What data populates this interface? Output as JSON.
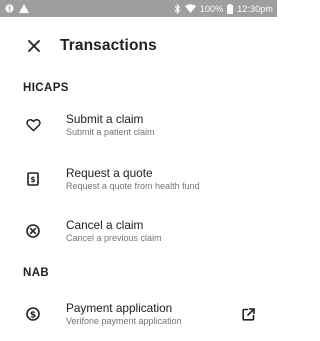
{
  "status_bar": {
    "battery_percent": "100%",
    "time": "12:30pm"
  },
  "header": {
    "title": "Transactions",
    "close_icon": "close-icon"
  },
  "sections": [
    {
      "label": "HICAPS",
      "items": [
        {
          "title": "Submit a claim",
          "subtitle": "Submit a patient claim",
          "icon": "heart-outline-icon"
        },
        {
          "title": "Request a quote",
          "subtitle": "Request a quote from health fund",
          "icon": "receipt-icon"
        },
        {
          "title": "Cancel a claim",
          "subtitle": "Cancel a previous claim",
          "icon": "cancel-circle-icon"
        }
      ]
    },
    {
      "label": "NAB",
      "items": [
        {
          "title": "Payment application",
          "subtitle": "Verifone payment application",
          "icon": "dollar-circle-icon",
          "trailing_icon": "open-external-icon"
        }
      ]
    }
  ]
}
